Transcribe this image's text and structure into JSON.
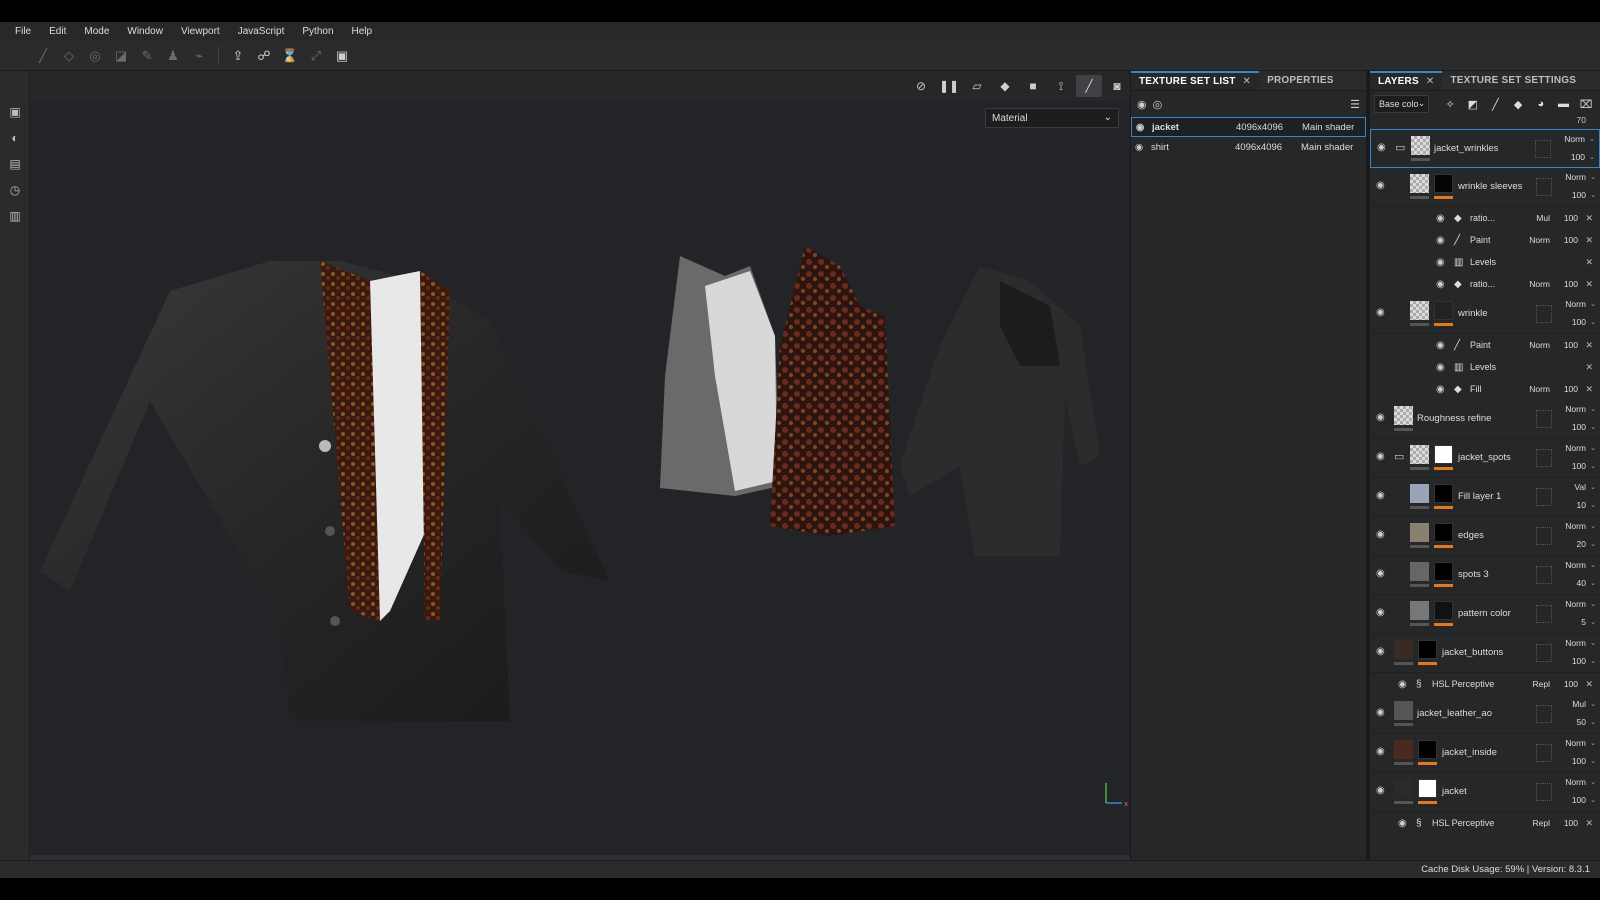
{
  "menu": [
    "File",
    "Edit",
    "Mode",
    "Window",
    "Viewport",
    "JavaScript",
    "Python",
    "Help"
  ],
  "toolbar_icons": [
    "paint-brush-icon",
    "eraser-icon",
    "projection-icon",
    "polygon-fill-icon",
    "smudge-icon",
    "clone-stamp-icon",
    "color-picker-icon",
    "export-icon",
    "bake-icon",
    "share-icon",
    "iray-icon",
    "save-icon"
  ],
  "left_icons": [
    "display-settings-icon",
    "shader-settings-icon",
    "assets-icon",
    "history-icon",
    "log-icon"
  ],
  "viewport": {
    "material_select": "Material",
    "icons": [
      "hide-icon",
      "pause-icon",
      "frame-icon",
      "cube-icon",
      "camera-icon",
      "symmetry-icon",
      "brush-icon",
      "screenshot-icon"
    ]
  },
  "texture_set_list": {
    "tab_label": "TEXTURE SET LIST",
    "tab_properties": "PROPERTIES",
    "rows": [
      {
        "name": "jacket",
        "res": "4096x4096",
        "shader": "Main shader"
      },
      {
        "name": "shirt",
        "res": "4096x4096",
        "shader": "Main shader"
      }
    ]
  },
  "layers": {
    "tab_label": "LAYERS",
    "tab_settings": "TEXTURE SET SETTINGS",
    "channel": "Base colo",
    "top_opacity": "70",
    "items": [
      {
        "name": "jacket_wrinkles",
        "blend": "Norm",
        "opacity": "100",
        "folder": true,
        "selected": true
      },
      {
        "name": "wrinkle sleeves",
        "blend": "Norm",
        "opacity": "100",
        "sub": [
          {
            "name": "ratio...",
            "icon": "fill-icon",
            "blend": "Mul",
            "opacity": "100"
          },
          {
            "name": "Paint",
            "icon": "brush-icon",
            "blend": "Norm",
            "opacity": "100"
          },
          {
            "name": "Levels",
            "icon": "levels-icon",
            "blend": "",
            "opacity": ""
          },
          {
            "name": "ratio...",
            "icon": "fill-icon",
            "blend": "Norm",
            "opacity": "100"
          }
        ]
      },
      {
        "name": "wrinkle",
        "blend": "Norm",
        "opacity": "100",
        "sub": [
          {
            "name": "Paint",
            "icon": "brush-icon",
            "blend": "Norm",
            "opacity": "100"
          },
          {
            "name": "Levels",
            "icon": "levels-icon",
            "blend": "",
            "opacity": ""
          },
          {
            "name": "Fill",
            "icon": "fill-icon",
            "blend": "Norm",
            "opacity": "100"
          }
        ]
      },
      {
        "name": "Roughness refine",
        "blend": "Norm",
        "opacity": "100"
      },
      {
        "name": "jacket_spots",
        "blend": "Norm",
        "opacity": "100",
        "folder": true
      },
      {
        "name": "Fill layer 1",
        "blend": "Val",
        "opacity": "10"
      },
      {
        "name": "edges",
        "blend": "Norm",
        "opacity": "20"
      },
      {
        "name": "spots 3",
        "blend": "Norm",
        "opacity": "40"
      },
      {
        "name": "pattern color",
        "blend": "Norm",
        "opacity": "5"
      },
      {
        "name": "jacket_buttons",
        "blend": "Norm",
        "opacity": "100",
        "sub": [
          {
            "name": "HSL Perceptive",
            "icon": "filter-icon",
            "blend": "Repl",
            "opacity": "100"
          }
        ]
      },
      {
        "name": "jacket_leather_ao",
        "blend": "Mul",
        "opacity": "50"
      },
      {
        "name": "jacket_inside",
        "blend": "Norm",
        "opacity": "100"
      },
      {
        "name": "jacket",
        "blend": "Norm",
        "opacity": "100",
        "sub": [
          {
            "name": "HSL Perceptive",
            "icon": "filter-icon",
            "blend": "Repl",
            "opacity": "100"
          }
        ]
      }
    ]
  },
  "status": "Cache Disk Usage:   59% | Version: 8.3.1"
}
